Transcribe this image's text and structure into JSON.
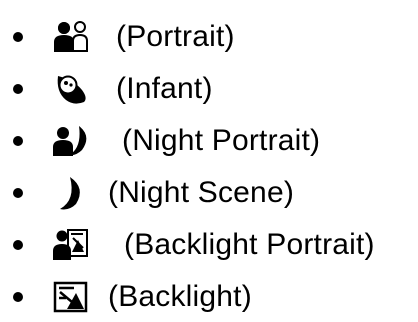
{
  "modes": [
    {
      "label": "(Portrait)",
      "icon": "portrait-icon"
    },
    {
      "label": "(Infant)",
      "icon": "infant-icon"
    },
    {
      "label": "(Night Portrait)",
      "icon": "night-portrait-icon"
    },
    {
      "label": "(Night Scene)",
      "icon": "night-scene-icon"
    },
    {
      "label": "(Backlight Portrait)",
      "icon": "backlight-portrait-icon"
    },
    {
      "label": "(Backlight)",
      "icon": "backlight-icon"
    }
  ]
}
